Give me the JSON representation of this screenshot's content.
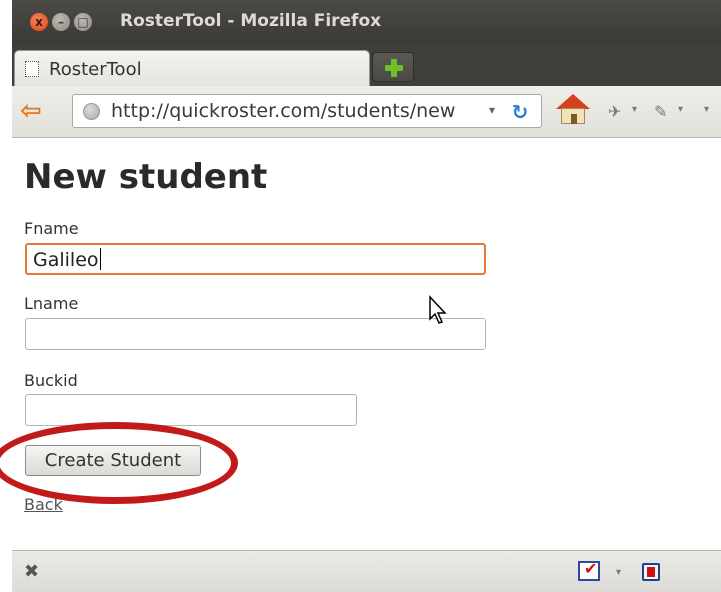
{
  "window": {
    "title": "RosterTool - Mozilla Firefox",
    "close_glyph": "x",
    "min_glyph": "–",
    "max_glyph": "□"
  },
  "tabs": [
    {
      "label": "RosterTool",
      "icon": "blank-page-icon"
    }
  ],
  "toolbar": {
    "url": "http://quickroster.com/students/new",
    "back_glyph": "⇦",
    "reload_glyph": "↻",
    "url_dropdown_glyph": "▾",
    "tool_glyph": "✈",
    "tool2_glyph": "✎",
    "dropdown_glyph": "▾"
  },
  "page": {
    "title": "New student",
    "form": {
      "fname": {
        "label": "Fname",
        "value": "Galileo"
      },
      "lname": {
        "label": "Lname",
        "value": ""
      },
      "buckid": {
        "label": "Buckid",
        "value": ""
      },
      "submit_label": "Create Student"
    },
    "back_link": "Back"
  },
  "statusbar": {
    "close_glyph": "✖",
    "check_glyph": "✔",
    "dropdown_glyph": "▾"
  },
  "colors": {
    "highlight": "#c21a1a",
    "focus_border": "#e8773a",
    "accent_orange": "#e8771c"
  }
}
